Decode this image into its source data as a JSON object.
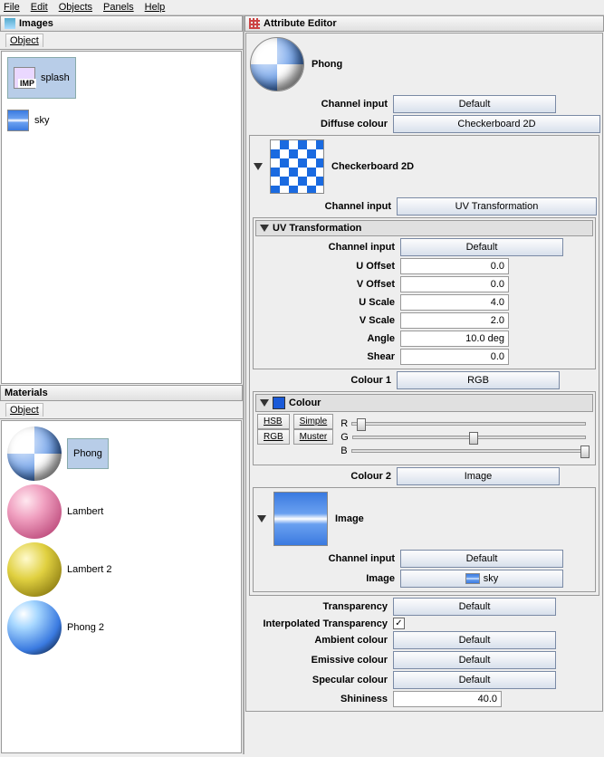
{
  "menu": {
    "file": "File",
    "edit": "Edit",
    "objects": "Objects",
    "panels": "Panels",
    "help": "Help"
  },
  "images_panel": {
    "title": "Images",
    "tab": "Object",
    "items": [
      {
        "name": "splash"
      },
      {
        "name": "sky"
      }
    ]
  },
  "materials_panel": {
    "title": "Materials",
    "tab": "Object",
    "items": [
      {
        "name": "Phong"
      },
      {
        "name": "Lambert"
      },
      {
        "name": "Lambert 2"
      },
      {
        "name": "Phong 2"
      }
    ]
  },
  "attr": {
    "title": "Attribute Editor",
    "phong": {
      "name": "Phong",
      "channel_input_label": "Channel input",
      "channel_input_val": "Default",
      "diffuse_label": "Diffuse colour",
      "diffuse_val": "Checkerboard 2D"
    },
    "checker": {
      "name": "Checkerboard 2D",
      "channel_input_label": "Channel input",
      "channel_input_val": "UV Transformation"
    },
    "uv": {
      "title": "UV Transformation",
      "channel_input_label": "Channel input",
      "channel_input_val": "Default",
      "u_offset_label": "U Offset",
      "u_offset_val": "0.0",
      "v_offset_label": "V Offset",
      "v_offset_val": "0.0",
      "u_scale_label": "U Scale",
      "u_scale_val": "4.0",
      "v_scale_label": "V Scale",
      "v_scale_val": "2.0",
      "angle_label": "Angle",
      "angle_val": "10.0 deg",
      "shear_label": "Shear",
      "shear_val": "0.0",
      "colour1_label": "Colour 1",
      "colour1_val": "RGB"
    },
    "colour": {
      "title": "Colour",
      "hsb": "HSB",
      "rgb": "RGB",
      "simple": "Simple",
      "muster": "Muster",
      "r": "R",
      "g": "G",
      "b": "B",
      "colour2_label": "Colour 2",
      "colour2_val": "Image"
    },
    "image": {
      "name": "Image",
      "channel_input_label": "Channel input",
      "channel_input_val": "Default",
      "image_label": "Image",
      "image_val": "sky"
    },
    "global": {
      "transparency_label": "Transparency",
      "transparency_val": "Default",
      "interp_trans_label": "Interpolated Transparency",
      "interp_trans_checked": "✓",
      "ambient_label": "Ambient colour",
      "ambient_val": "Default",
      "emissive_label": "Emissive colour",
      "emissive_val": "Default",
      "specular_label": "Specular colour",
      "specular_val": "Default",
      "shininess_label": "Shininess",
      "shininess_val": "40.0"
    }
  }
}
